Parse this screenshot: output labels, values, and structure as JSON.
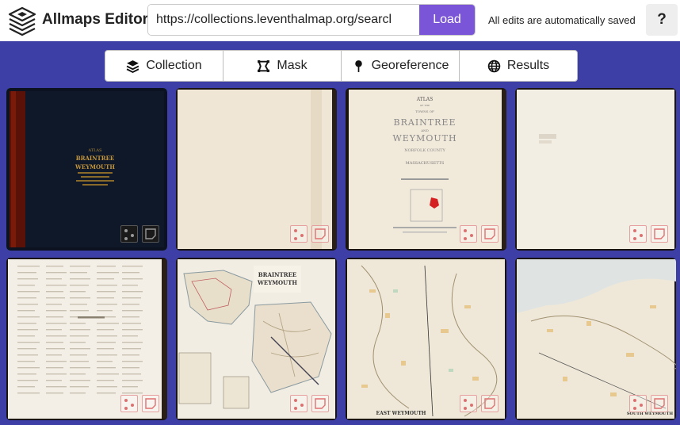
{
  "header": {
    "app_title": "Allmaps Editor",
    "url_value": "https://collections.leventhalmap.org/searcl",
    "load_label": "Load",
    "saved_status": "All edits are automatically saved",
    "help_label": "?"
  },
  "tabs": [
    {
      "label": "Collection",
      "icon": "layers-icon"
    },
    {
      "label": "Mask",
      "icon": "mask-icon"
    },
    {
      "label": "Georeference",
      "icon": "pin-icon"
    },
    {
      "label": "Results",
      "icon": "globe-icon"
    }
  ],
  "colors": {
    "background": "#3d3ea6",
    "accent": "#7a55d8",
    "selected": "#3fbf7f",
    "badge": "#e07070"
  },
  "cover_text": {
    "line1": "ATLAS",
    "line2": "BRAINTREE",
    "line3": "WEYMOUTH"
  },
  "title_page": {
    "atlas": "ATLAS",
    "of_the": "OF THE",
    "towns_of": "TOWNS OF",
    "braintree": "BRAINTREE",
    "and": "AND",
    "weymouth": "WEYMOUTH",
    "county": "NORFOLK COUNTY",
    "state": "MASSACHUSETTS"
  },
  "map_title": {
    "line1": "BRAINTREE",
    "line2": "WEYMOUTH"
  },
  "map_caption_1": "EAST WEYMOUTH",
  "map_caption_2": "SOUTH WEYMOUTH"
}
